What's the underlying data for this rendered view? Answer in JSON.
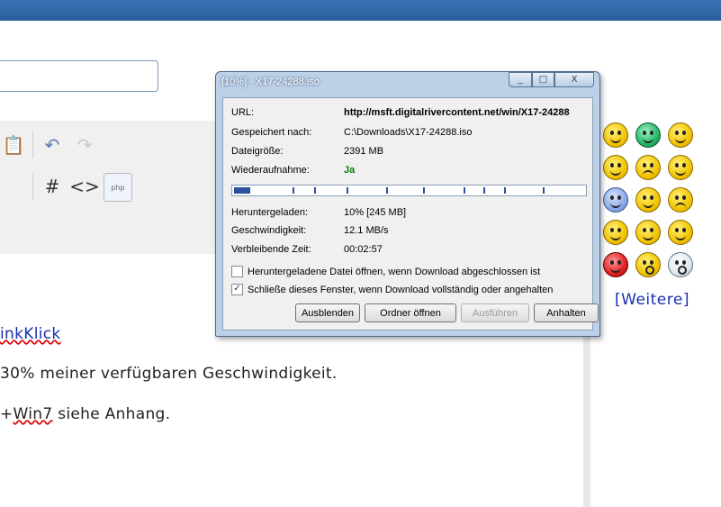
{
  "page": {
    "content_lines": [
      {
        "text": "inkKlick",
        "type": "link"
      },
      {
        "text": "30% meiner verfügbaren Geschwindigkeit.",
        "type": "text"
      },
      {
        "prefix": "+",
        "spell": "Win7",
        "suffix": " siehe Anhang.",
        "type": "mixed"
      }
    ],
    "more_smileys_label": "[Weitere]"
  },
  "dialog": {
    "title": "[10%] - X17-24288.iso",
    "min_label": "_",
    "max_label": "□",
    "close_label": "X",
    "fields": [
      {
        "label": "URL:",
        "value": "http://msft.digitalrivercontent.net/win/X17-24288"
      },
      {
        "label": "Gespeichert nach:",
        "value": "C:\\Downloads\\X17-24288.iso"
      },
      {
        "label": "Dateigröße:",
        "value": "2391 MB"
      },
      {
        "label": "Wiederaufnahme:",
        "value": "Ja"
      }
    ],
    "progress_fraction": 0.1,
    "stats": [
      {
        "label": "Heruntergeladen:",
        "value": "10% [245 MB]"
      },
      {
        "label": "Geschwindigkeit:",
        "value": "12.1 MB/s"
      },
      {
        "label": "Verbleibende Zeit:",
        "value": "00:02:57"
      }
    ],
    "checkboxes": [
      {
        "label": "Heruntergeladene Datei öffnen, wenn Download abgeschlossen ist",
        "checked": false
      },
      {
        "label": "Schließe dieses Fenster, wenn Download vollständig oder angehalten",
        "checked": true
      }
    ],
    "buttons": [
      {
        "label": "Ausblenden",
        "enabled": true
      },
      {
        "label": "Ordner öffnen",
        "enabled": true
      },
      {
        "label": "Ausführen",
        "enabled": false
      },
      {
        "label": "Anhalten",
        "enabled": true
      }
    ]
  },
  "toolbar": {
    "hash_label": "#",
    "code_label": "<>",
    "php_label": "php"
  },
  "colors": {
    "accent": "#2c4f9e",
    "link": "#1a2fb0"
  }
}
